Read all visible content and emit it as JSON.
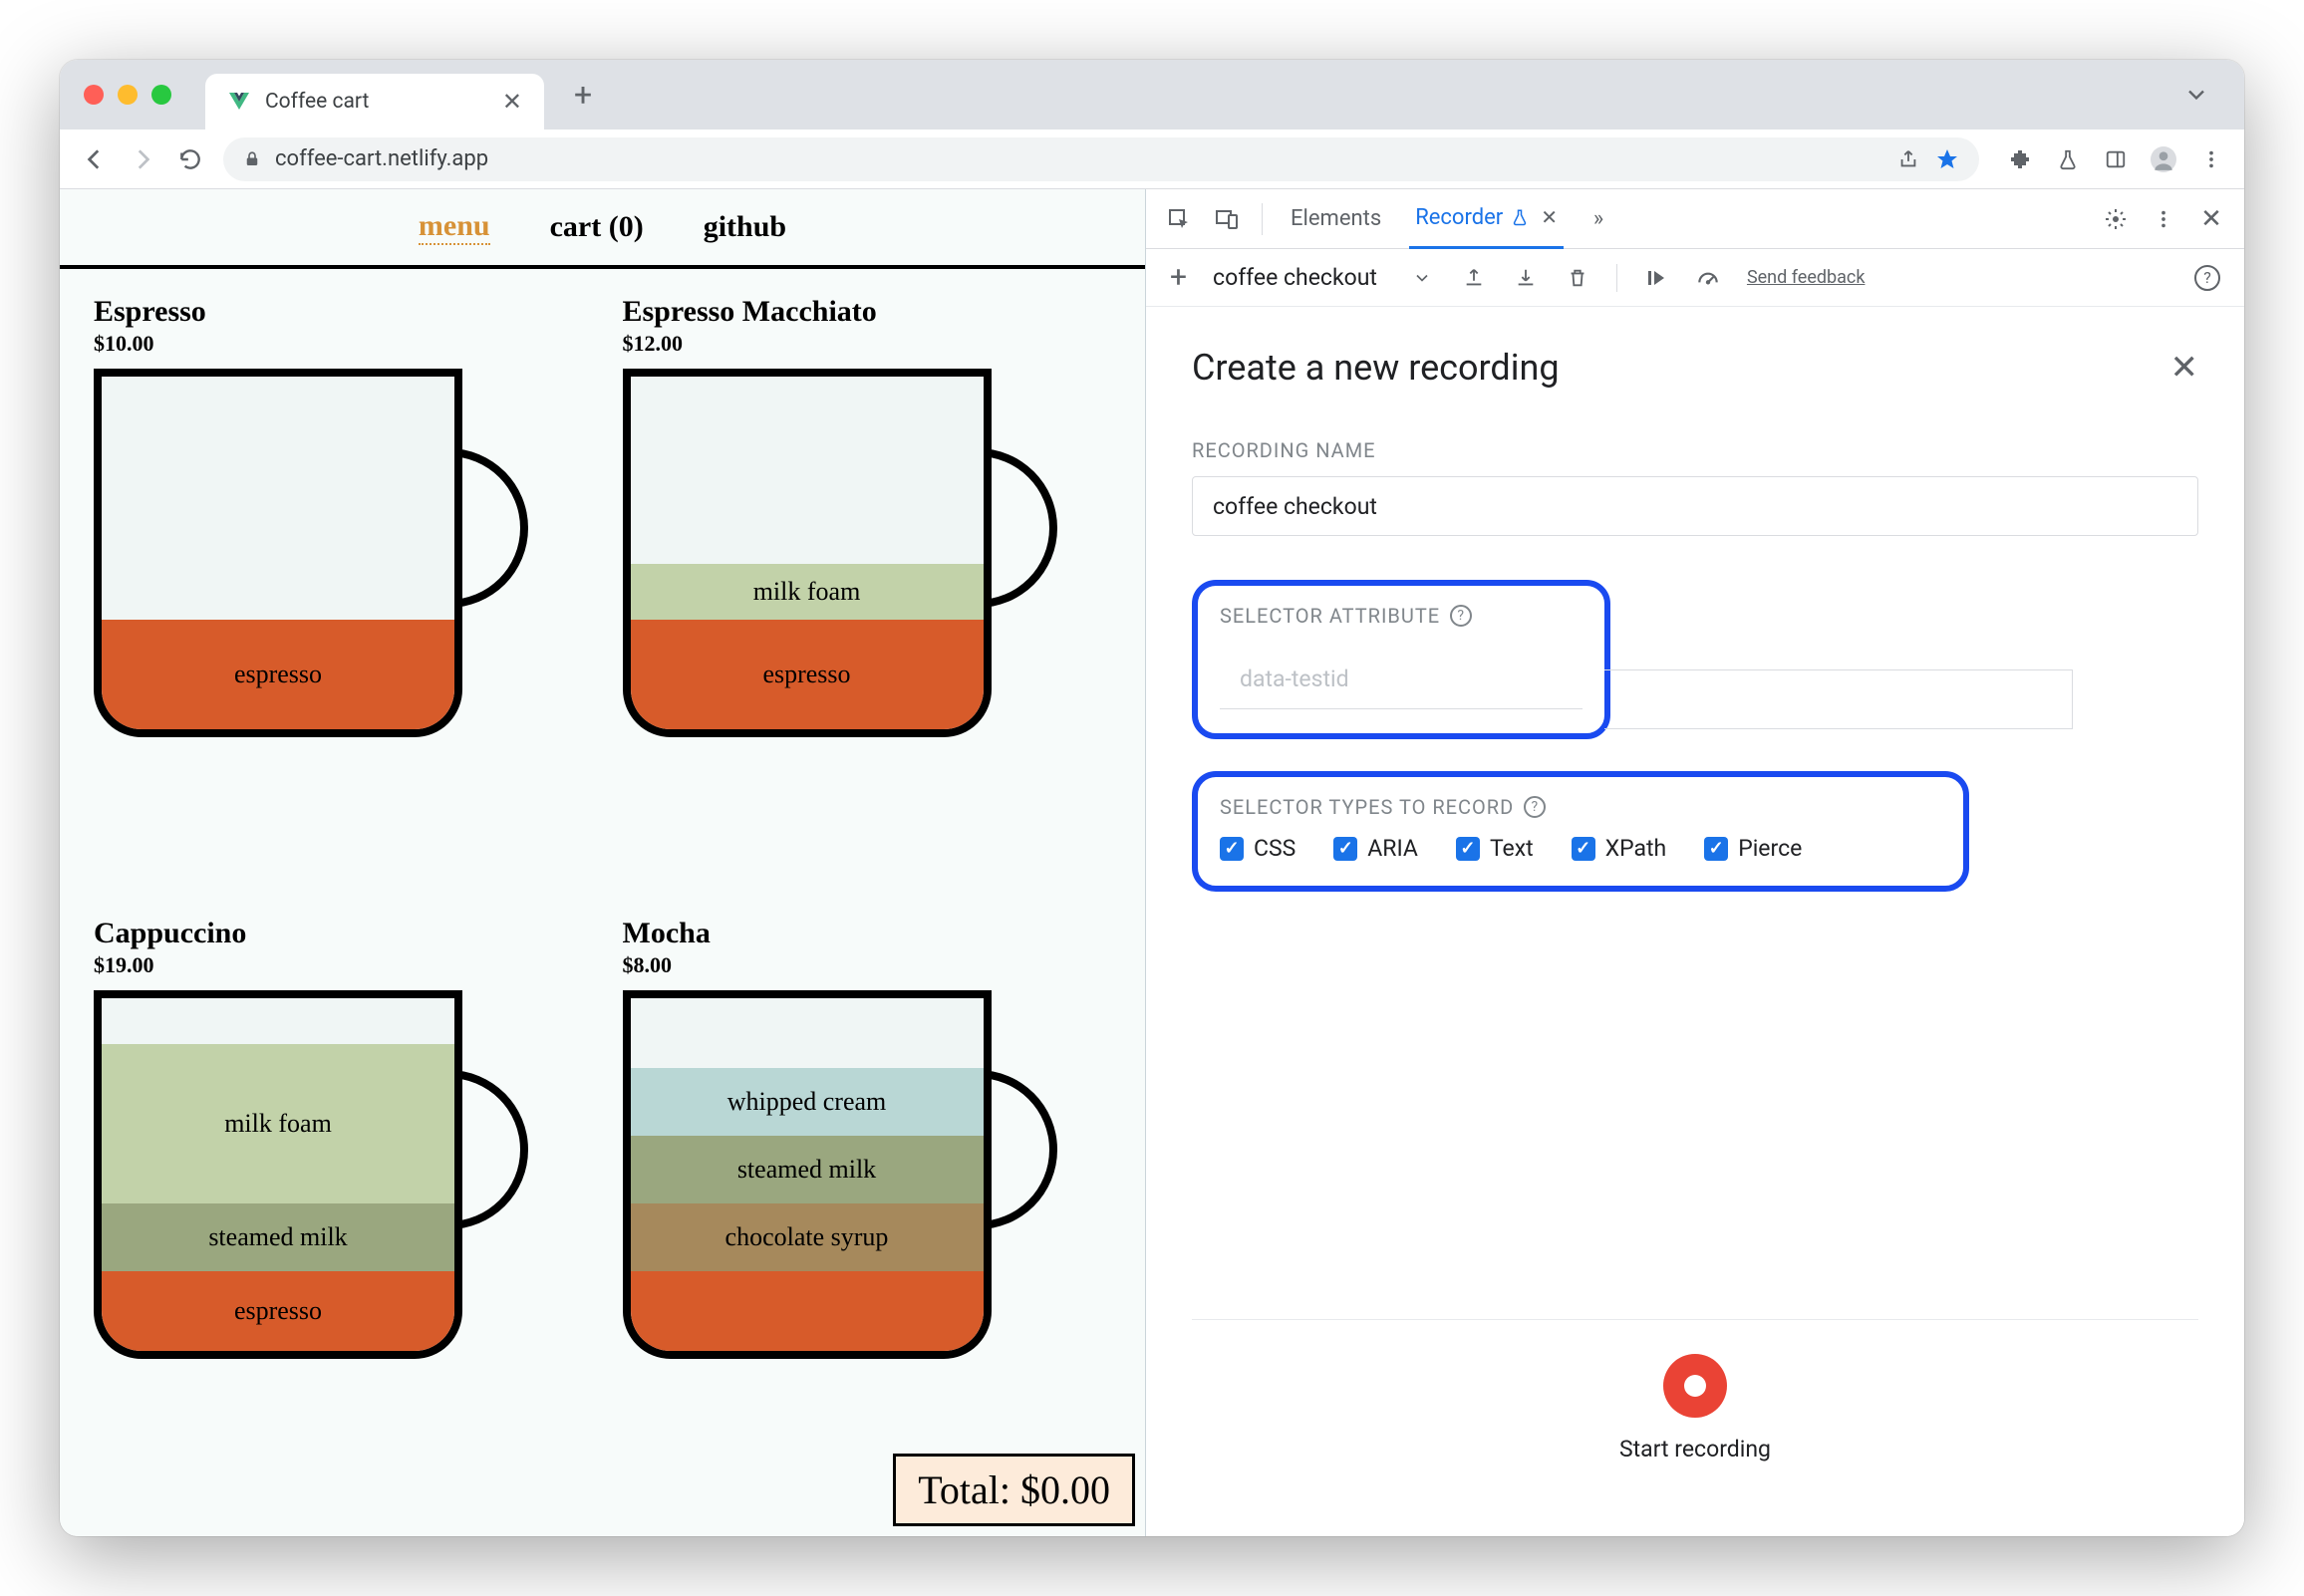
{
  "browser": {
    "tab_title": "Coffee cart",
    "url": "coffee-cart.netlify.app"
  },
  "app": {
    "nav": {
      "menu": "menu",
      "cart": "cart (0)",
      "github": "github"
    },
    "products": [
      {
        "name": "Espresso",
        "price": "$10.00"
      },
      {
        "name": "Espresso Macchiato",
        "price": "$12.00"
      },
      {
        "name": "Cappuccino",
        "price": "$19.00"
      },
      {
        "name": "Mocha",
        "price": "$8.00"
      }
    ],
    "layers": {
      "espresso": "espresso",
      "milkfoam": "milk foam",
      "steamed": "steamed milk",
      "chocolate": "chocolate syrup",
      "whipped": "whipped cream"
    },
    "total": "Total: $0.00"
  },
  "devtools": {
    "tabs": {
      "elements": "Elements",
      "recorder": "Recorder"
    },
    "flow_name": "coffee checkout",
    "feedback": "Send feedback",
    "panel": {
      "title": "Create a new recording",
      "recording_name_label": "RECORDING NAME",
      "recording_name_value": "coffee checkout",
      "selector_attr_label": "SELECTOR ATTRIBUTE",
      "selector_attr_placeholder": "data-testid",
      "selector_types_label": "SELECTOR TYPES TO RECORD",
      "selector_types": [
        "CSS",
        "ARIA",
        "Text",
        "XPath",
        "Pierce"
      ],
      "start_label": "Start recording"
    }
  }
}
